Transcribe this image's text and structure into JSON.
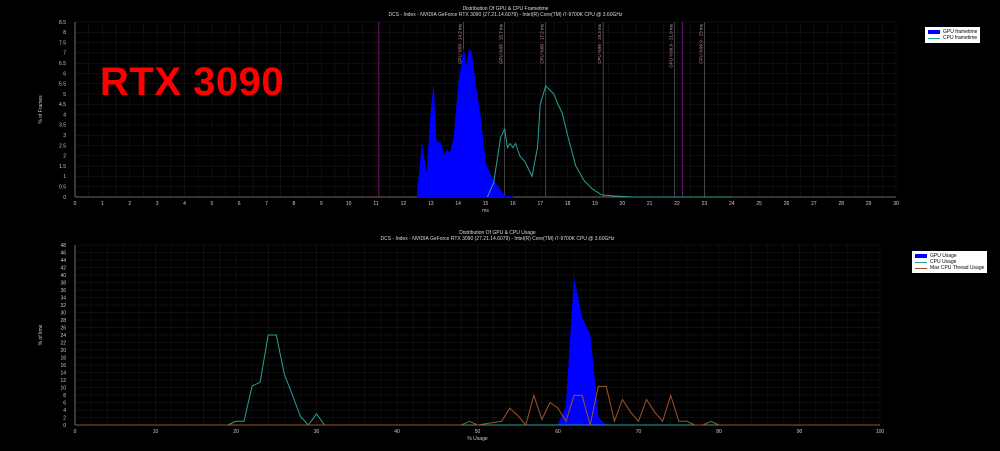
{
  "overlay_label": "RTX 3090",
  "chart_data": [
    {
      "type": "area",
      "title": "Distribution Of GPU & CPU Frametime",
      "subtitle": "DCS - Index - NVIDIA GeForce RTX 3090 (27.21.14.6079) - Intel(R) Core(TM) i7-9700K CPU @ 3.60GHz",
      "xlabel": "ms",
      "ylabel": "% of Frames",
      "xlim": [
        0,
        30
      ],
      "ylim": [
        0,
        8.5
      ],
      "xticks": [
        "0",
        "1",
        "2",
        "3",
        "4",
        "5",
        "6",
        "7",
        "8",
        "9",
        "10",
        "11",
        "12",
        "13",
        "14",
        "15",
        "16",
        "17",
        "18",
        "19",
        "20",
        "21",
        "22",
        "23",
        "24",
        "25",
        "26",
        "27",
        "28",
        "29",
        "30"
      ],
      "yticks": [
        "0",
        "0.5",
        "1",
        "1.5",
        "2",
        "2.5",
        "3",
        "3.5",
        "4",
        "4.5",
        "5",
        "5.5",
        "6",
        "6.5",
        "7",
        "7.5",
        "8",
        "8.5"
      ],
      "grid": true,
      "legend_position": "top-right",
      "series": [
        {
          "name": "GPU frametime",
          "style": "filled",
          "color": "#0000ff",
          "x": [
            12.5,
            12.68,
            12.85,
            13.0,
            13.1,
            13.2,
            13.37,
            13.5,
            13.6,
            13.7,
            13.85,
            14.0,
            14.2,
            14.3,
            14.4,
            14.5,
            14.65,
            14.8,
            15.0,
            15.2,
            15.45,
            15.7,
            16.0
          ],
          "y": [
            0,
            2.6,
            1.1,
            4.1,
            5.4,
            2.75,
            2.6,
            2.0,
            2.3,
            2.1,
            2.9,
            5.3,
            7.2,
            6.3,
            7.2,
            7.0,
            5.3,
            4.1,
            1.7,
            1.0,
            0.5,
            0.07,
            0
          ]
        },
        {
          "name": "CPU frametime",
          "style": "line",
          "color": "#2aa198",
          "x": [
            15.07,
            15.3,
            15.55,
            15.7,
            15.8,
            15.9,
            16.0,
            16.1,
            16.25,
            16.45,
            16.7,
            16.9,
            17.0,
            17.2,
            17.5,
            17.65,
            17.8,
            18.0,
            18.3,
            18.6,
            18.9,
            19.25,
            19.7,
            20.4,
            24.0
          ],
          "y": [
            0,
            0.7,
            2.9,
            3.3,
            2.4,
            2.6,
            2.4,
            2.6,
            2.0,
            1.7,
            1.0,
            2.4,
            4.5,
            5.4,
            5.0,
            4.5,
            4.1,
            3.0,
            1.5,
            0.8,
            0.4,
            0.1,
            0.05,
            0,
            0
          ]
        }
      ],
      "percentile_lines": [
        {
          "label": "GPU %50 - 14.2 ms",
          "value": 14.2
        },
        {
          "label": "GPU %95 - 15.7 ms",
          "value": 15.7
        },
        {
          "label": "CPU %50 - 17.2 ms",
          "value": 17.2
        },
        {
          "label": "CPU %95 - 19.3 ms",
          "value": 19.3
        },
        {
          "label": "GPU %99.9 - 21.9 ms",
          "value": 21.9
        },
        {
          "label": "CPU %99.9 - 23 ms",
          "value": 23
        }
      ],
      "refresh_lines": [
        11.1,
        22.2
      ]
    },
    {
      "type": "area",
      "title": "Distribution Of GPU & CPU Usage",
      "subtitle": "DCS - Index - NVIDIA GeForce RTX 3090 (27.21.14.6079) - Intel(R) Core(TM) i7-9700K CPU @ 3.60GHz",
      "xlabel": "% Usage",
      "ylabel": "% of time",
      "xlim": [
        0,
        100
      ],
      "ylim": [
        0,
        48
      ],
      "xticks": [
        "0",
        "10",
        "20",
        "30",
        "40",
        "50",
        "60",
        "70",
        "80",
        "90",
        "100"
      ],
      "yticks": [
        "0",
        "2",
        "4",
        "6",
        "8",
        "10",
        "12",
        "14",
        "16",
        "18",
        "20",
        "22",
        "24",
        "26",
        "28",
        "30",
        "32",
        "34",
        "36",
        "38",
        "40",
        "42",
        "44",
        "46",
        "48"
      ],
      "grid": true,
      "legend_position": "top-right",
      "series": [
        {
          "name": "GPU Usage",
          "style": "filled",
          "color": "#0000ff",
          "x": [
            60,
            61,
            62,
            63,
            64,
            65,
            66
          ],
          "y": [
            0,
            5,
            39,
            28.6,
            24,
            2,
            0
          ]
        },
        {
          "name": "CPU Usage",
          "style": "line",
          "color": "#2aa198",
          "x": [
            0,
            19,
            20,
            21,
            22,
            23,
            24,
            25,
            26,
            27,
            28,
            29,
            30,
            31,
            100
          ],
          "y": [
            0,
            0,
            1,
            1,
            10.4,
            11.4,
            24,
            24,
            13.6,
            8,
            2.3,
            0,
            3,
            0,
            0
          ]
        },
        {
          "name": "Max CPU Thread Usage",
          "style": "line",
          "color": "#a0522d",
          "x": [
            0,
            48,
            49,
            50,
            53,
            54,
            55,
            56,
            57,
            58,
            59,
            60,
            61,
            62,
            63,
            64,
            65,
            66,
            67,
            68,
            69,
            70,
            71,
            72,
            73,
            74,
            75,
            76,
            77,
            78,
            79,
            80,
            100
          ],
          "y": [
            0,
            0,
            1,
            0,
            1,
            4.5,
            2.5,
            0,
            7.9,
            1.5,
            6,
            4.5,
            1,
            7.9,
            7.9,
            0,
            10.3,
            10.3,
            1,
            6.8,
            3.5,
            1,
            6.8,
            3.5,
            1,
            7.9,
            1,
            1,
            0,
            0,
            1,
            0,
            0
          ]
        }
      ]
    }
  ]
}
